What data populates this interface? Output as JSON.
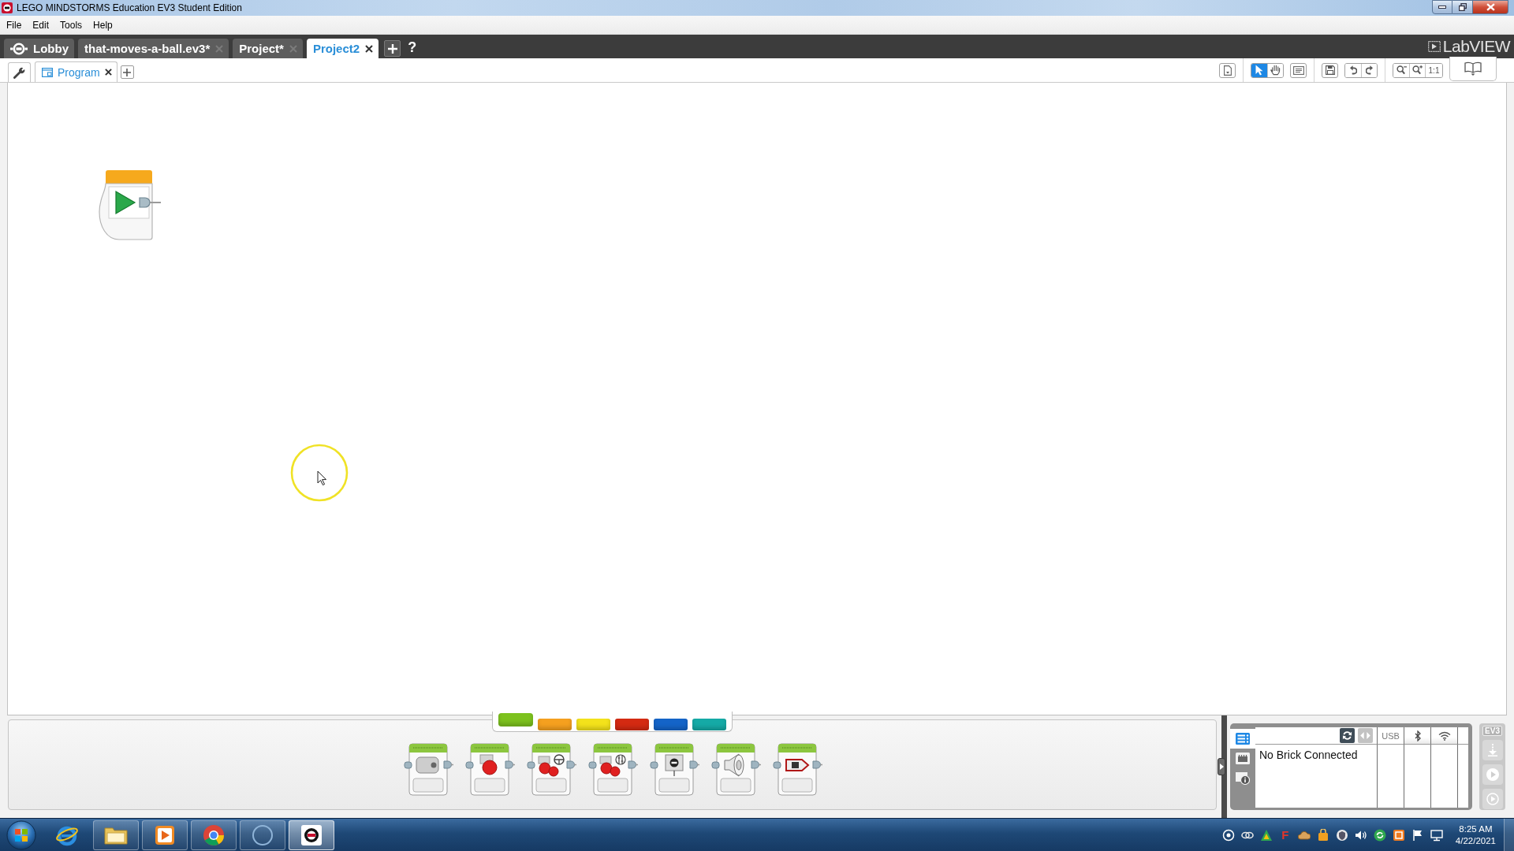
{
  "window": {
    "title": "LEGO MINDSTORMS Education EV3 Student Edition"
  },
  "menu_bar": [
    {
      "label": "File"
    },
    {
      "label": "Edit"
    },
    {
      "label": "Tools"
    },
    {
      "label": "Help"
    }
  ],
  "project_tabs": [
    {
      "kind": "lobby",
      "label": "Lobby",
      "selected": false
    },
    {
      "kind": "project",
      "label": "that-moves-a-ball.ev3*",
      "selected": false
    },
    {
      "kind": "project",
      "label": "Project*",
      "selected": false
    },
    {
      "kind": "project",
      "label": "Project2",
      "selected": true
    }
  ],
  "tab_bar": {
    "help": "?"
  },
  "brand": {
    "name": "LabVIEW"
  },
  "program_tabs": [
    {
      "label": "Program",
      "selected": true
    }
  ],
  "toolbar": {
    "tools": [
      {
        "kind": "pointer",
        "selected": true
      },
      {
        "kind": "pan",
        "selected": false
      }
    ],
    "zoom_reset": "1:1"
  },
  "palette": {
    "categories": [
      {
        "color": "#7dc21e",
        "selected": true
      },
      {
        "color": "#f5a01f",
        "selected": false
      },
      {
        "color": "#f3e21b",
        "selected": false
      },
      {
        "color": "#d42a12",
        "selected": false
      },
      {
        "color": "#1464c8",
        "selected": false
      },
      {
        "color": "#15aaa6",
        "selected": false
      }
    ],
    "blocks": [
      {
        "kind": "medium-motor"
      },
      {
        "kind": "large-motor"
      },
      {
        "kind": "steering"
      },
      {
        "kind": "tank"
      },
      {
        "kind": "display"
      },
      {
        "kind": "sound"
      },
      {
        "kind": "light"
      }
    ]
  },
  "hardware": {
    "tabs": [
      {
        "kind": "brick-info",
        "selected": true
      },
      {
        "kind": "ports",
        "selected": false
      },
      {
        "kind": "bricks",
        "selected": false
      }
    ],
    "buttons": [
      {
        "kind": "refresh",
        "disabled": false
      },
      {
        "kind": "arrows",
        "disabled": true
      }
    ],
    "columns": [
      {
        "kind": "usb",
        "label": "USB"
      },
      {
        "kind": "bluetooth"
      },
      {
        "kind": "wifi"
      }
    ],
    "status": "No Brick Connected"
  },
  "brick_panel": {
    "label": "EV3",
    "buttons": [
      {
        "kind": "download",
        "disabled": true
      },
      {
        "kind": "run",
        "disabled": true
      },
      {
        "kind": "run-selected",
        "disabled": true
      }
    ]
  },
  "taskbar": {
    "apps": [
      {
        "kind": "letter-e",
        "running": false,
        "selected": false
      },
      {
        "kind": "folder",
        "running": true,
        "selected": false
      },
      {
        "kind": "play",
        "running": true,
        "selected": false
      },
      {
        "kind": "circles",
        "running": true,
        "selected": false
      },
      {
        "kind": "ring",
        "running": true,
        "selected": false
      },
      {
        "kind": "brick",
        "running": true,
        "selected": true
      }
    ],
    "tray": [
      {
        "kind": "target"
      },
      {
        "kind": "link"
      },
      {
        "kind": "drive"
      },
      {
        "kind": "letter",
        "glyph": "F"
      },
      {
        "kind": "cloud"
      },
      {
        "kind": "bag"
      },
      {
        "kind": "shield"
      },
      {
        "kind": "speaker"
      },
      {
        "kind": "sync"
      },
      {
        "kind": "box"
      },
      {
        "kind": "flag"
      },
      {
        "kind": "network"
      }
    ],
    "time": "8:25 AM",
    "date": "4/22/2021"
  }
}
